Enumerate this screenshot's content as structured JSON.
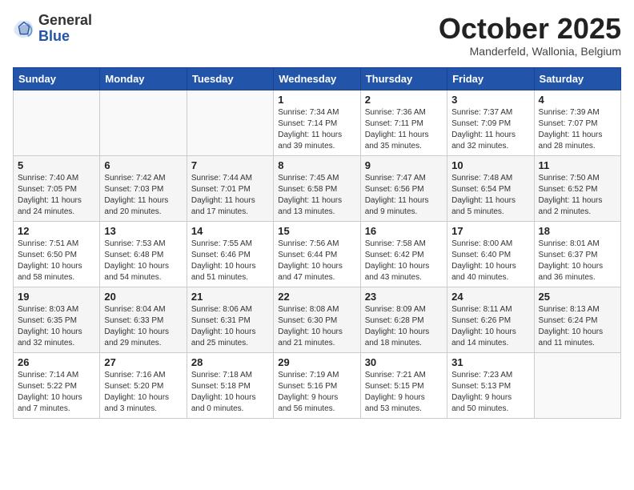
{
  "header": {
    "logo_general": "General",
    "logo_blue": "Blue",
    "month_title": "October 2025",
    "subtitle": "Manderfeld, Wallonia, Belgium"
  },
  "weekdays": [
    "Sunday",
    "Monday",
    "Tuesday",
    "Wednesday",
    "Thursday",
    "Friday",
    "Saturday"
  ],
  "rows": [
    [
      {
        "day": "",
        "info": ""
      },
      {
        "day": "",
        "info": ""
      },
      {
        "day": "",
        "info": ""
      },
      {
        "day": "1",
        "info": "Sunrise: 7:34 AM\nSunset: 7:14 PM\nDaylight: 11 hours\nand 39 minutes."
      },
      {
        "day": "2",
        "info": "Sunrise: 7:36 AM\nSunset: 7:11 PM\nDaylight: 11 hours\nand 35 minutes."
      },
      {
        "day": "3",
        "info": "Sunrise: 7:37 AM\nSunset: 7:09 PM\nDaylight: 11 hours\nand 32 minutes."
      },
      {
        "day": "4",
        "info": "Sunrise: 7:39 AM\nSunset: 7:07 PM\nDaylight: 11 hours\nand 28 minutes."
      }
    ],
    [
      {
        "day": "5",
        "info": "Sunrise: 7:40 AM\nSunset: 7:05 PM\nDaylight: 11 hours\nand 24 minutes."
      },
      {
        "day": "6",
        "info": "Sunrise: 7:42 AM\nSunset: 7:03 PM\nDaylight: 11 hours\nand 20 minutes."
      },
      {
        "day": "7",
        "info": "Sunrise: 7:44 AM\nSunset: 7:01 PM\nDaylight: 11 hours\nand 17 minutes."
      },
      {
        "day": "8",
        "info": "Sunrise: 7:45 AM\nSunset: 6:58 PM\nDaylight: 11 hours\nand 13 minutes."
      },
      {
        "day": "9",
        "info": "Sunrise: 7:47 AM\nSunset: 6:56 PM\nDaylight: 11 hours\nand 9 minutes."
      },
      {
        "day": "10",
        "info": "Sunrise: 7:48 AM\nSunset: 6:54 PM\nDaylight: 11 hours\nand 5 minutes."
      },
      {
        "day": "11",
        "info": "Sunrise: 7:50 AM\nSunset: 6:52 PM\nDaylight: 11 hours\nand 2 minutes."
      }
    ],
    [
      {
        "day": "12",
        "info": "Sunrise: 7:51 AM\nSunset: 6:50 PM\nDaylight: 10 hours\nand 58 minutes."
      },
      {
        "day": "13",
        "info": "Sunrise: 7:53 AM\nSunset: 6:48 PM\nDaylight: 10 hours\nand 54 minutes."
      },
      {
        "day": "14",
        "info": "Sunrise: 7:55 AM\nSunset: 6:46 PM\nDaylight: 10 hours\nand 51 minutes."
      },
      {
        "day": "15",
        "info": "Sunrise: 7:56 AM\nSunset: 6:44 PM\nDaylight: 10 hours\nand 47 minutes."
      },
      {
        "day": "16",
        "info": "Sunrise: 7:58 AM\nSunset: 6:42 PM\nDaylight: 10 hours\nand 43 minutes."
      },
      {
        "day": "17",
        "info": "Sunrise: 8:00 AM\nSunset: 6:40 PM\nDaylight: 10 hours\nand 40 minutes."
      },
      {
        "day": "18",
        "info": "Sunrise: 8:01 AM\nSunset: 6:37 PM\nDaylight: 10 hours\nand 36 minutes."
      }
    ],
    [
      {
        "day": "19",
        "info": "Sunrise: 8:03 AM\nSunset: 6:35 PM\nDaylight: 10 hours\nand 32 minutes."
      },
      {
        "day": "20",
        "info": "Sunrise: 8:04 AM\nSunset: 6:33 PM\nDaylight: 10 hours\nand 29 minutes."
      },
      {
        "day": "21",
        "info": "Sunrise: 8:06 AM\nSunset: 6:31 PM\nDaylight: 10 hours\nand 25 minutes."
      },
      {
        "day": "22",
        "info": "Sunrise: 8:08 AM\nSunset: 6:30 PM\nDaylight: 10 hours\nand 21 minutes."
      },
      {
        "day": "23",
        "info": "Sunrise: 8:09 AM\nSunset: 6:28 PM\nDaylight: 10 hours\nand 18 minutes."
      },
      {
        "day": "24",
        "info": "Sunrise: 8:11 AM\nSunset: 6:26 PM\nDaylight: 10 hours\nand 14 minutes."
      },
      {
        "day": "25",
        "info": "Sunrise: 8:13 AM\nSunset: 6:24 PM\nDaylight: 10 hours\nand 11 minutes."
      }
    ],
    [
      {
        "day": "26",
        "info": "Sunrise: 7:14 AM\nSunset: 5:22 PM\nDaylight: 10 hours\nand 7 minutes."
      },
      {
        "day": "27",
        "info": "Sunrise: 7:16 AM\nSunset: 5:20 PM\nDaylight: 10 hours\nand 3 minutes."
      },
      {
        "day": "28",
        "info": "Sunrise: 7:18 AM\nSunset: 5:18 PM\nDaylight: 10 hours\nand 0 minutes."
      },
      {
        "day": "29",
        "info": "Sunrise: 7:19 AM\nSunset: 5:16 PM\nDaylight: 9 hours\nand 56 minutes."
      },
      {
        "day": "30",
        "info": "Sunrise: 7:21 AM\nSunset: 5:15 PM\nDaylight: 9 hours\nand 53 minutes."
      },
      {
        "day": "31",
        "info": "Sunrise: 7:23 AM\nSunset: 5:13 PM\nDaylight: 9 hours\nand 50 minutes."
      },
      {
        "day": "",
        "info": ""
      }
    ]
  ]
}
